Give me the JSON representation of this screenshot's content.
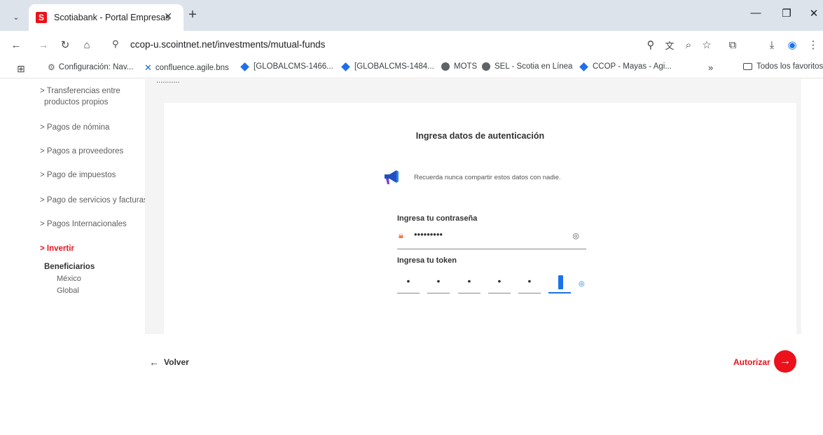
{
  "browser": {
    "tab": {
      "title": "Scotiabank - Portal Empresas",
      "favicon_letter": "S",
      "close": "✕"
    },
    "new_tab": "+",
    "url": "ccop-u.scointnet.net/investments/mutual-funds",
    "bookmarks": [
      {
        "label": "Configuración: Nav...",
        "icon": "gear-icon"
      },
      {
        "label": "confluence.agile.bns",
        "icon": "confluence-icon"
      },
      {
        "label": "[GLOBALCMS-1466...",
        "icon": "jira-icon"
      },
      {
        "label": "[GLOBALCMS-1484...",
        "icon": "jira-icon"
      },
      {
        "label": "MOTS",
        "icon": "globe-icon"
      },
      {
        "label": "SEL - Scotia en Línea",
        "icon": "globe-icon"
      },
      {
        "label": "CCOP - Mayas - Agi...",
        "icon": "jira-icon"
      }
    ],
    "more_bookmarks": "»",
    "all_bookmarks": "Todos los favoritos"
  },
  "sidebar": {
    "items": [
      {
        "label": "> Transferencias entre",
        "label2": "productos propios"
      },
      {
        "label": "> Pagos de nómina"
      },
      {
        "label": "> Pagos a proveedores"
      },
      {
        "label": "> Pago de impuestos"
      },
      {
        "label": "> Pago de servicios y facturas"
      },
      {
        "label": "> Pagos Internacionales"
      },
      {
        "label": "> Invertir"
      }
    ],
    "section_title": "Beneficiarios",
    "sub_items": [
      "México",
      "Global"
    ]
  },
  "panel": {
    "partial_text": "...........",
    "title": "Ingresa datos de autenticación",
    "reminder": "Recuerda nunca compartir estos datos con nadie.",
    "password": {
      "label": "Ingresa tu contraseña",
      "value": "•••••••••"
    },
    "token": {
      "label": "Ingresa tu token",
      "digits": [
        "•",
        "•",
        "•",
        "•",
        "•",
        ""
      ]
    }
  },
  "footer": {
    "back_label": "Volver",
    "authorize_label": "Autorizar"
  },
  "colors": {
    "brand_red": "#ec111a",
    "focus_blue": "#1a73e8"
  }
}
